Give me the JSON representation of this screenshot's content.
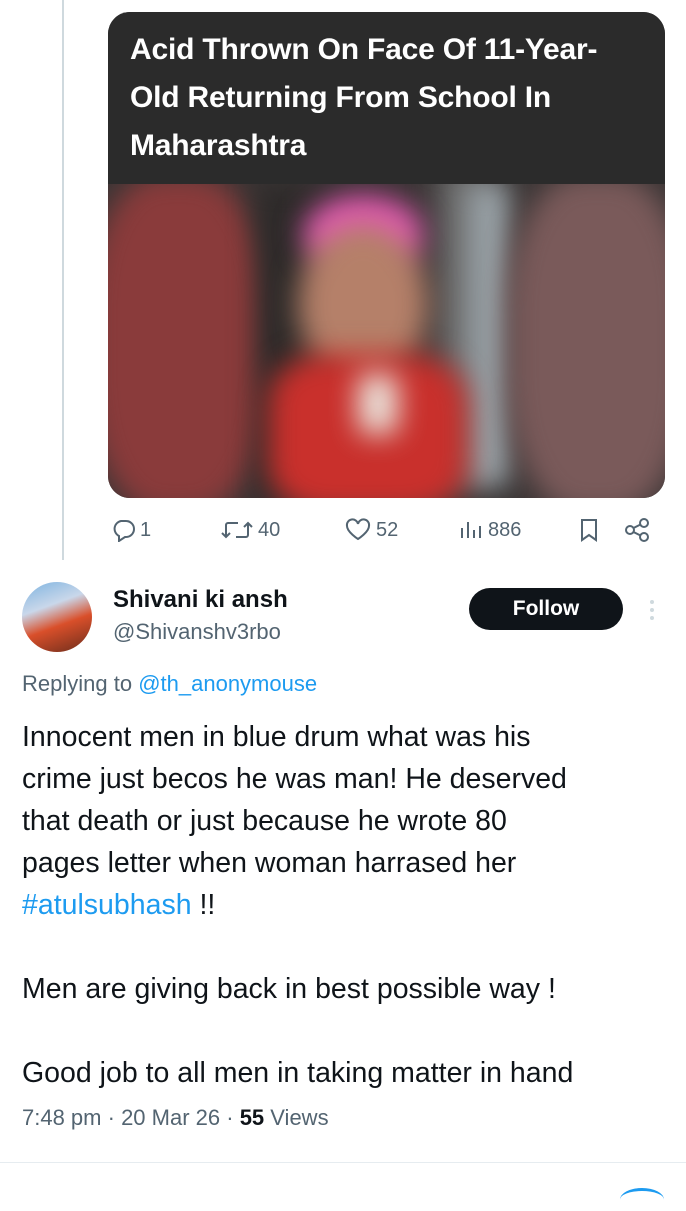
{
  "quoted_media": {
    "headline": "Acid Thrown On Face Of 11-Year-Old Returning From School In Maharashtra"
  },
  "quoted_actions": {
    "replies": "1",
    "reposts": "40",
    "likes": "52",
    "views": "886"
  },
  "reply": {
    "display_name": "Shivani ki ansh",
    "handle": "@Shivanshv3rbo",
    "follow_label": "Follow",
    "replying_prefix": "Replying to",
    "replying_mention": "@th_anonymouse",
    "body_lines": [
      "Innocent men in blue drum what was his",
      "crime just becos he was man! He deserved",
      "that death or just because he wrote 80",
      "pages letter when woman harrased her"
    ],
    "hashtag": "#atulsubhash",
    "hashtag_suffix": " !!",
    "paragraph2": "Men are giving back in best possible way !",
    "paragraph3": "Good job to all men in taking matter in hand",
    "time": "7:48 pm",
    "sep1": " · ",
    "date": "20 Mar 26",
    "sep2": " · ",
    "views_count": "55",
    "views_label": " Views"
  },
  "colors": {
    "accent": "#1d9bf0",
    "text": "#0f1419",
    "muted": "#536471"
  }
}
